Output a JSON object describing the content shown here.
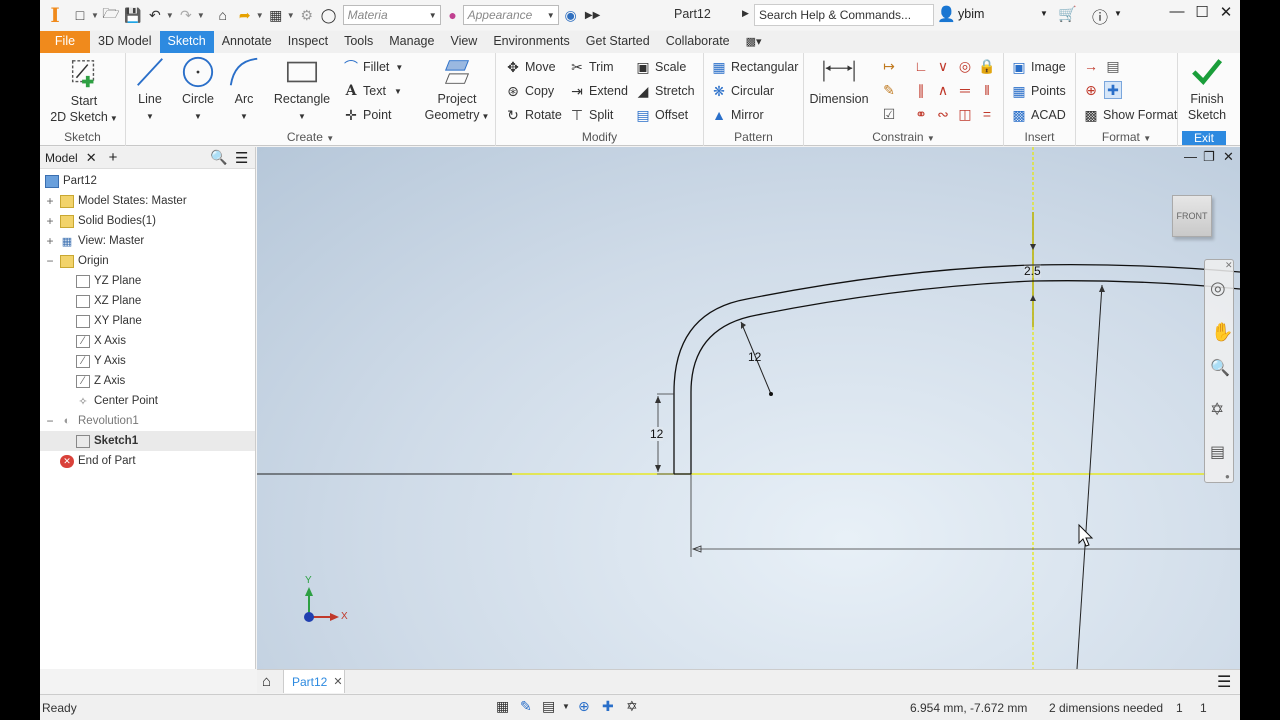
{
  "title_bar": {
    "material_placeholder": "Materia",
    "appearance_placeholder": "Appearance",
    "document_name": "Part12",
    "search_placeholder": "Search Help & Commands...",
    "user_name": "ybim"
  },
  "tabs": [
    "File",
    "3D Model",
    "Sketch",
    "Annotate",
    "Inspect",
    "Tools",
    "Manage",
    "View",
    "Environments",
    "Get Started",
    "Collaborate"
  ],
  "ribbon": {
    "sketch_panel": {
      "label": "Sketch",
      "start_line1": "Start",
      "start_line2": "2D Sketch"
    },
    "create_panel": {
      "label": "Create",
      "line": "Line",
      "circle": "Circle",
      "arc": "Arc",
      "rectangle": "Rectangle",
      "fillet": "Fillet",
      "text": "Text",
      "point": "Point",
      "project_line1": "Project",
      "project_line2": "Geometry"
    },
    "modify_panel": {
      "label": "Modify",
      "move": "Move",
      "copy": "Copy",
      "rotate": "Rotate",
      "trim": "Trim",
      "extend": "Extend",
      "split": "Split",
      "scale": "Scale",
      "stretch": "Stretch",
      "offset": "Offset"
    },
    "pattern_panel": {
      "label": "Pattern",
      "rectangular": "Rectangular",
      "circular": "Circular",
      "mirror": "Mirror"
    },
    "constrain_panel": {
      "label": "Constrain",
      "dimension": "Dimension"
    },
    "insert_panel": {
      "label": "Insert",
      "image": "Image",
      "points": "Points",
      "acad": "ACAD"
    },
    "format_panel": {
      "label": "Format",
      "show_format": "Show Format"
    },
    "exit_panel": {
      "label": "Exit",
      "finish_line1": "Finish",
      "finish_line2": "Sketch"
    }
  },
  "browser": {
    "tab_label": "Model",
    "items": [
      {
        "label": "Part12"
      },
      {
        "label": "Model States: Master"
      },
      {
        "label": "Solid Bodies(1)"
      },
      {
        "label": "View: Master"
      },
      {
        "label": "Origin"
      },
      {
        "label": "YZ Plane"
      },
      {
        "label": "XZ Plane"
      },
      {
        "label": "XY Plane"
      },
      {
        "label": "X Axis"
      },
      {
        "label": "Y Axis"
      },
      {
        "label": "Z Axis"
      },
      {
        "label": "Center Point"
      },
      {
        "label": "Revolution1"
      },
      {
        "label": "Sketch1"
      },
      {
        "label": "End of Part"
      }
    ]
  },
  "canvas": {
    "viewcube_label": "FRONT",
    "dim_thickness": "2.5",
    "dim_radius": "12",
    "dim_height": "12",
    "axis_y": "Y",
    "axis_x": "X"
  },
  "doc_tab": "Part12",
  "status": {
    "message": "Ready",
    "coordinates": "6.954 mm, -7.672 mm",
    "dimensions_needed": "2 dimensions needed",
    "count1": "1",
    "count2": "1"
  },
  "colors": {
    "accent": "#2d8ae0",
    "file_tab": "#f08a1c",
    "finish_check": "#1a9e3a",
    "sketch_yellow": "#e8e800"
  }
}
